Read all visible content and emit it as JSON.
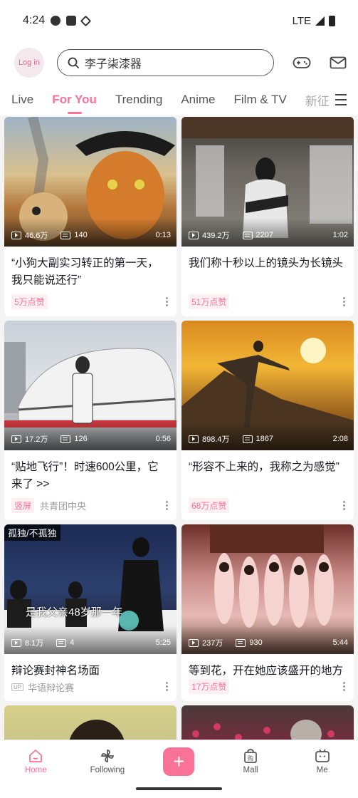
{
  "status_bar": {
    "time": "4:24",
    "network": "LTE"
  },
  "header": {
    "login_label": "Log in",
    "search_placeholder": "李子柒漆器"
  },
  "tabs": [
    {
      "label": "Live",
      "active": false
    },
    {
      "label": "For You",
      "active": true
    },
    {
      "label": "Trending",
      "active": false
    },
    {
      "label": "Anime",
      "active": false
    },
    {
      "label": "Film & TV",
      "active": false
    },
    {
      "label": "新征",
      "active": false
    }
  ],
  "cards": [
    {
      "views": "46.6万",
      "danmaku": "140",
      "duration": "0:13",
      "title": "“小狗大副实习转正的第一天，我只能说还行”",
      "tag": "5万点赞",
      "author": ""
    },
    {
      "views": "439.2万",
      "danmaku": "2207",
      "duration": "1:02",
      "title": "我们称十秒以上的镜头为长镜头",
      "tag": "51万点赞",
      "author": ""
    },
    {
      "views": "17.2万",
      "danmaku": "126",
      "duration": "0:56",
      "title": "“贴地飞行”！时速600公里，它来了 >>",
      "tag": "竖屏",
      "author": "共青团中央"
    },
    {
      "views": "898.4万",
      "danmaku": "1867",
      "duration": "2:08",
      "title": "“形容不上来的，我称之为感觉”",
      "tag": "68万点赞",
      "author": ""
    },
    {
      "views": "8.1万",
      "danmaku": "4",
      "duration": "5:25",
      "title": "辩论赛封神名场面",
      "up_badge": "UP",
      "author": "华语辩论赛",
      "overlay": "孤独/不孤独",
      "subtitle": "是我父亲48岁那一年"
    },
    {
      "views": "237万",
      "danmaku": "930",
      "duration": "5:44",
      "title": "等到花，开在她应该盛开的地方",
      "tag": "17万点赞",
      "author": ""
    }
  ],
  "bottom_nav": {
    "home": "Home",
    "following": "Following",
    "add": "+",
    "mall": "Mall",
    "me": "Me"
  },
  "colors": {
    "accent": "#fb7299"
  }
}
